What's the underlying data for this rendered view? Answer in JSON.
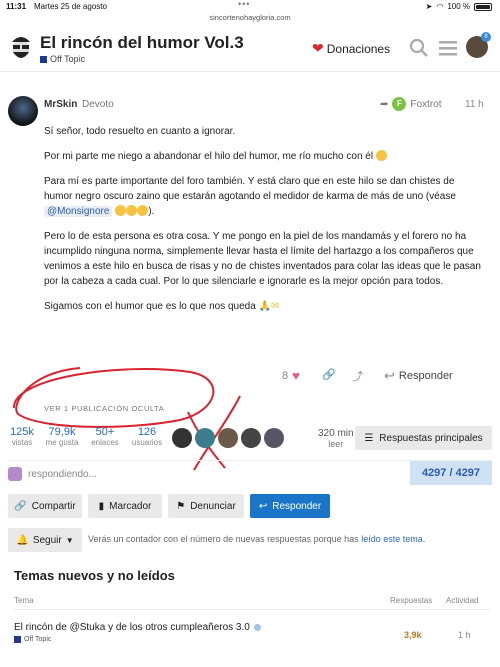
{
  "status_bar": {
    "time": "11:31",
    "date": "Martes 25 de agosto",
    "url": "sincortenohaygloria.com",
    "battery": "100 %"
  },
  "header": {
    "title": "El rincón del humor Vol.3",
    "category": "Off Topic",
    "donate_label": "Donaciones",
    "notification_count": "8",
    "colors": {
      "category": "#1f3a93",
      "badge": "#3a8bd6"
    }
  },
  "post": {
    "author": "MrSkin",
    "author_sub": "Devoto",
    "reply_to_initial": "F",
    "reply_to": "Foxtrot",
    "time": "11 h",
    "paragraphs": [
      "Sí señor, todo resuelto en cuanto a ignorar.",
      "Por mi parte me niego a abandonar el hilo del humor, me río mucho con él",
      "Para mí es parte importante del foro también. Y está claro que en este hilo se dan chistes de humor negro oscuro zaino que estarán agotando el medidor de karma de más de uno (véase",
      "Pero lo de esta persona es otra cosa. Y me pongo en la piel de los mandamás y el forero no ha incumplido ninguna norma, simplemente llevar hasta el límite del hartazgo a los compañeros que venimos a este hilo en busca de risas y no de chistes inventados para colar las ideas que le pasan por la cabeza a cada cual. Por lo que silenciarle e ignorarle es la mejor opción para todos.",
      "Sigamos con el humor que es lo que nos queda"
    ],
    "mention": "@Monsignore",
    "close_paren": ").",
    "likes": "8",
    "reply_label": "Responder"
  },
  "hidden_posts_label": "VER 1 PUBLICACIÓN OCULTA",
  "stats": [
    {
      "num": "125k",
      "label": "vistas"
    },
    {
      "num": "79,9k",
      "label": "me gusta"
    },
    {
      "num": "50+",
      "label": "enlaces"
    },
    {
      "num": "126",
      "label": "usuarios"
    }
  ],
  "read_time": {
    "num": "320 min",
    "label": "leer"
  },
  "summary_label": "Respuestas principales",
  "typing_label": "respondiendo...",
  "progress": "4297 / 4297",
  "buttons": {
    "share": "Compartir",
    "bookmark": "Marcador",
    "flag": "Denunciar",
    "reply": "Responder"
  },
  "notify": {
    "label": "Seguir",
    "text": "Verás un contador con el número de nuevas respuestas porque has",
    "link": "leído este tema",
    "end": "."
  },
  "suggested": {
    "title": "Temas nuevos y no leídos",
    "columns": [
      "Tema",
      "Respuestas",
      "Actividad"
    ],
    "rows": [
      {
        "title": "El rincón de @Stuka y de los otros cumpleañeros 3.0",
        "category": "Off Topic",
        "replies": "3,9k",
        "activity": "1 h"
      }
    ]
  }
}
